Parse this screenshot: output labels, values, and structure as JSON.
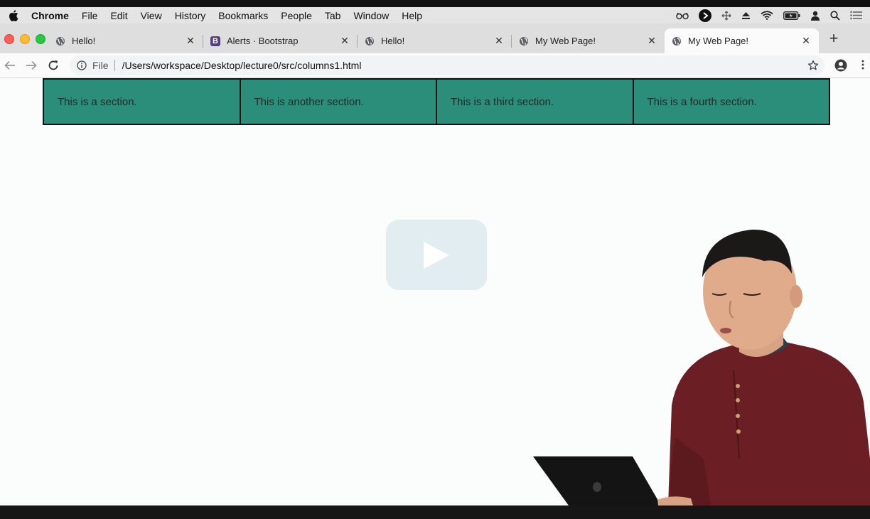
{
  "menubar": {
    "app": "Chrome",
    "items": [
      "File",
      "Edit",
      "View",
      "History",
      "Bookmarks",
      "People",
      "Tab",
      "Window",
      "Help"
    ]
  },
  "tabs": [
    {
      "title": "Hello!",
      "icon": "globe-icon"
    },
    {
      "title": "Alerts · Bootstrap",
      "icon": "bootstrap-icon",
      "badge": "B"
    },
    {
      "title": "Hello!",
      "icon": "globe-icon"
    },
    {
      "title": "My Web Page!",
      "icon": "globe-icon"
    },
    {
      "title": "My Web Page!",
      "icon": "globe-icon",
      "active": true
    }
  ],
  "toolbar": {
    "scheme": "File",
    "url": "/Users/workspace/Desktop/lecture0/src/columns1.html"
  },
  "page": {
    "sections": [
      "This is a section.",
      "This is another section.",
      "This is a third section.",
      "This is a fourth section."
    ]
  },
  "colors": {
    "section_bg": "#2b8e7a",
    "section_border": "#111111",
    "page_bg": "#fbfdfc",
    "sweater": "#6b1f24"
  }
}
